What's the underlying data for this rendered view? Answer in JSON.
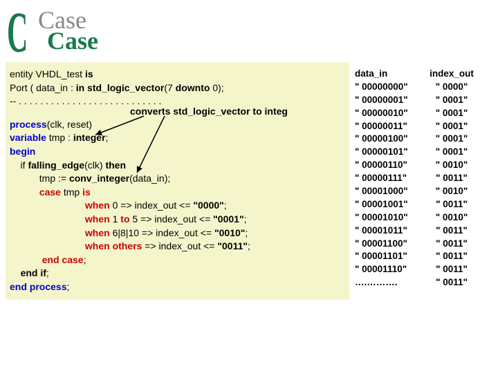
{
  "title": {
    "c": "C",
    "case1": "Case",
    "case2": "Case"
  },
  "code": {
    "l1_a": "entity VHDL_test ",
    "l1_b": "is",
    "l2_a": "Port ( data_in : ",
    "l2_b": "in",
    "l2_c": " std_logic_vector",
    "l2_d": "(7 ",
    "l2_e": "downto",
    "l2_f": " 0);",
    "l3": "-- . . . . . . . . . . . . . . . . . . . . . . . . . . .",
    "l4_a": "process",
    "l4_b": "(clk, reset)",
    "l5_a": "variable",
    "l5_b": " tmp : ",
    "l5_c": "integer",
    "l5_d": ";",
    "l6": "begin",
    "l7_a": "    if ",
    "l7_b": "falling_edge",
    "l7_c": "(clk) ",
    "l7_d": "then",
    "l8_a": "           tmp := ",
    "l8_b": "conv_integer",
    "l8_c": "(data_in);",
    "l9_a": "           ",
    "l9_b": "case",
    "l9_c": " tmp ",
    "l9_d": "is",
    "l10_a": "                            when",
    "l10_b": " 0 => index_out <= ",
    "l10_c": "\"0000\"",
    "l10_d": ";",
    "l11_a": "                            when",
    "l11_b": " 1 ",
    "l11_c": "to",
    "l11_d": " 5 => index_out <= ",
    "l11_e": "\"0001\"",
    "l11_f": ";",
    "l12_a": "                            when",
    "l12_b": " 6|8|10 => index_out <= ",
    "l12_c": "\"0010\"",
    "l12_d": ";",
    "l13_a": "                            when others",
    "l13_b": " => index_out <= ",
    "l13_c": "\"0011\"",
    "l13_d": ";",
    "l14_a": "            ",
    "l14_b": "end case",
    "l14_c": ";",
    "l15_a": "    ",
    "l15_b": "end if",
    "l15_c": ";",
    "l16_a": "end process",
    "l16_b": ";"
  },
  "annotation": {
    "text_a": "converts ",
    "text_b": "std_logic_vector",
    "text_c": " to ",
    "text_d": "integ"
  },
  "table": {
    "hdr_in": "data_in",
    "hdr_out": "index_out",
    "rows": [
      {
        "in": "\" 00000000\"",
        "out": "\" 0000\""
      },
      {
        "in": "\" 00000001\"",
        "out": "\" 0001\""
      },
      {
        "in": "\" 00000010\"",
        "out": "\" 0001\""
      },
      {
        "in": "\" 00000011\"",
        "out": "\" 0001\""
      },
      {
        "in": "\" 00000100\"",
        "out": "\" 0001\""
      },
      {
        "in": "\" 00000101\"",
        "out": "\" 0001\""
      },
      {
        "in": "\" 00000110\"",
        "out": "\" 0010\""
      },
      {
        "in": "\" 00000111\"",
        "out": "\" 0011\""
      },
      {
        "in": "\" 00001000\"",
        "out": "\" 0010\""
      },
      {
        "in": "\" 00001001\"",
        "out": "\" 0011\""
      },
      {
        "in": "\" 00001010\"",
        "out": "\" 0010\""
      },
      {
        "in": "\" 00001011\"",
        "out": "\" 0011\""
      },
      {
        "in": "\" 00001100\"",
        "out": "\" 0011\""
      },
      {
        "in": "\" 00001101\"",
        "out": "\" 0011\""
      },
      {
        "in": "\" 00001110\"",
        "out": "\" 0011\""
      },
      {
        "in": "….……….",
        "out": "\" 0011\""
      }
    ]
  }
}
